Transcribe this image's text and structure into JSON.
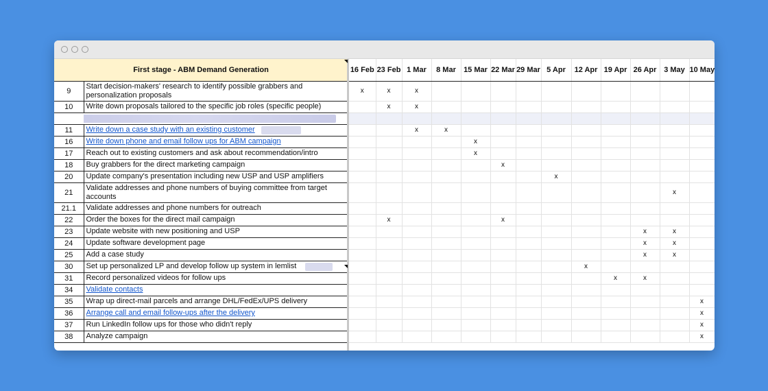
{
  "header": {
    "stage_title": "First stage - ABM Demand Generation"
  },
  "dates": [
    "16 Feb",
    "23 Feb",
    "1 Mar",
    "8 Mar",
    "15 Mar",
    "22 Mar",
    "29 Mar",
    "5 Apr",
    "12 Apr",
    "19 Apr",
    "26 Apr",
    "3 May",
    "10 May"
  ],
  "marker": "x",
  "rows": [
    {
      "num": "9",
      "task": "Start decision-makers' research to identify possible grabbers and personalization proposals",
      "link": false,
      "marks": [
        0,
        1,
        2
      ],
      "tall": true
    },
    {
      "num": "10",
      "task": "Write down proposals tailored to the specific job roles (specific people)",
      "link": false,
      "marks": [
        1,
        2
      ]
    },
    {
      "num": "",
      "task": "",
      "blurred": true,
      "marks": []
    },
    {
      "num": "11",
      "task": "Write down a case study with an existing customer",
      "link": true,
      "marks": [
        2,
        3
      ]
    },
    {
      "num": "16",
      "task": "Write down phone and email follow ups for ABM campaign",
      "link": true,
      "marks": [
        4
      ]
    },
    {
      "num": "17",
      "task": "Reach out to existing customers and ask about recommendation/intro",
      "link": false,
      "marks": [
        4
      ]
    },
    {
      "num": "18",
      "task": "Buy grabbers for the direct marketing campaign",
      "link": false,
      "marks": [
        5
      ]
    },
    {
      "num": "20",
      "task": "Update company's presentation including new USP and USP amplifiers",
      "link": false,
      "marks": [
        7
      ]
    },
    {
      "num": "21",
      "task": "Validate addresses and phone numbers of buying committee from target accounts",
      "link": false,
      "marks": [
        11
      ],
      "tall": true
    },
    {
      "num": "21.1",
      "task": "Validate addresses and phone numbers for outreach",
      "link": false,
      "marks": []
    },
    {
      "num": "22",
      "task": "Order the boxes for the direct mail campaign",
      "link": false,
      "marks": [
        1,
        5
      ]
    },
    {
      "num": "23",
      "task": "Update website with new positioning and USP",
      "link": false,
      "marks": [
        10,
        11
      ]
    },
    {
      "num": "24",
      "task": "Update software development page",
      "link": false,
      "marks": [
        10,
        11
      ]
    },
    {
      "num": "25",
      "task": "Add a case study",
      "link": false,
      "marks": [
        10,
        11
      ]
    },
    {
      "num": "30",
      "task": "Set up personalized LP and develop follow up system in lemlist",
      "link": false,
      "marks": [
        8
      ]
    },
    {
      "num": "31",
      "task": "Record personalized videos for follow ups",
      "link": false,
      "marks": [
        9,
        10
      ]
    },
    {
      "num": "34",
      "task": "Validate contacts",
      "link": true,
      "marks": []
    },
    {
      "num": "35",
      "task": "Wrap up direct-mail parcels and arrange DHL/FedEx/UPS delivery",
      "link": false,
      "marks": [
        12
      ]
    },
    {
      "num": "36",
      "task": "Arrange call and email follow-ups after the delivery",
      "link": true,
      "marks": [
        12
      ]
    },
    {
      "num": "37",
      "task": "Run LinkedIn follow ups for those who didn't reply",
      "link": false,
      "marks": [
        12
      ]
    },
    {
      "num": "38",
      "task": "Analyze campaign",
      "link": false,
      "marks": [
        12
      ]
    }
  ]
}
